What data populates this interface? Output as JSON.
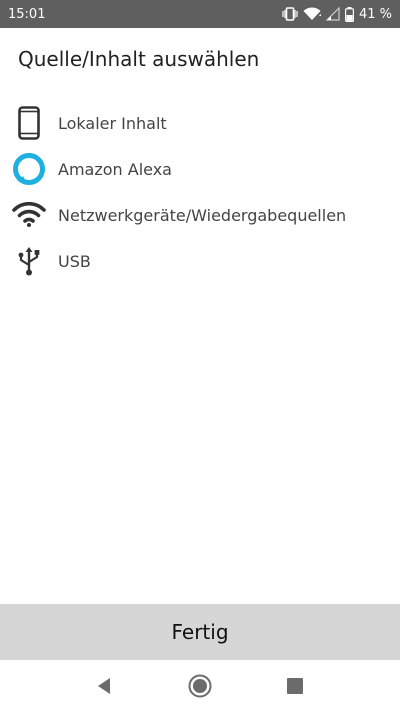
{
  "status_bar": {
    "time": "15:01",
    "battery_percent": "41 %",
    "icons": [
      "vibrate-icon",
      "wifi-icon",
      "signal-icon",
      "battery-icon"
    ]
  },
  "dialog": {
    "title": "Quelle/Inhalt auswählen",
    "items": [
      {
        "label": "Lokaler Inhalt",
        "icon": "phone-icon"
      },
      {
        "label": "Amazon Alexa",
        "icon": "alexa-icon"
      },
      {
        "label": "Netzwerkgeräte/Wiedergabequellen",
        "icon": "wifi-icon"
      },
      {
        "label": "USB",
        "icon": "usb-icon"
      }
    ],
    "done_label": "Fertig"
  },
  "nav": {
    "icons": [
      "back-icon",
      "home-icon",
      "recents-icon"
    ]
  },
  "colors": {
    "status_bar": "#5f5f5f",
    "done_bar": "#d6d6d6",
    "alexa_accent": "#1fb0e0",
    "icon_dark": "#333333"
  }
}
